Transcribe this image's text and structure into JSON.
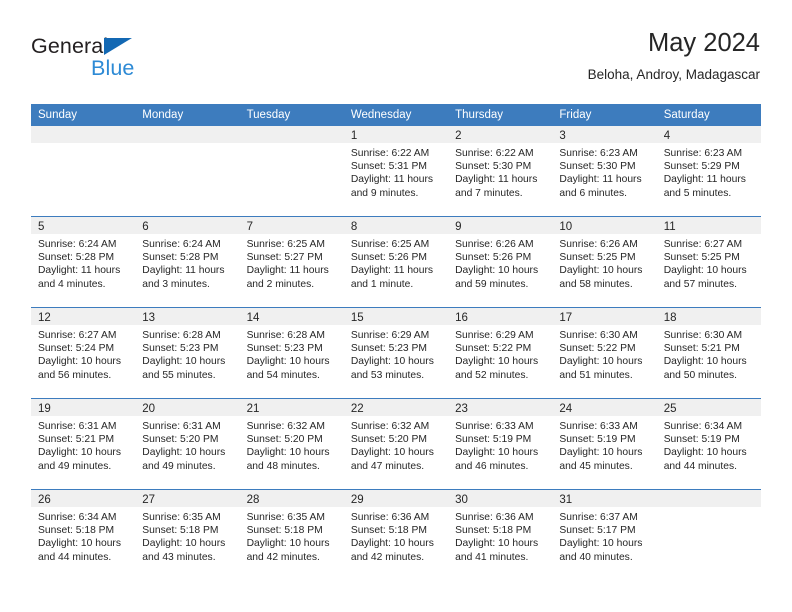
{
  "brand": {
    "name_top": "General",
    "name_bottom": "Blue",
    "triangle_color": "#1368b3",
    "blue_color": "#2d8ad5",
    "dark_color": "#231f20"
  },
  "header": {
    "title": "May 2024",
    "subtitle": "Beloha, Androy, Madagascar"
  },
  "theme": {
    "header_blue": "#3d7cbe",
    "daynum_band": "#f0f0f0",
    "text": "#262626"
  },
  "weekday_headers": [
    "Sunday",
    "Monday",
    "Tuesday",
    "Wednesday",
    "Thursday",
    "Friday",
    "Saturday"
  ],
  "weeks": [
    [
      {
        "day": "",
        "empty": true,
        "sunrise": "",
        "sunset": "",
        "daylight1": "",
        "daylight2": ""
      },
      {
        "day": "",
        "empty": true,
        "sunrise": "",
        "sunset": "",
        "daylight1": "",
        "daylight2": ""
      },
      {
        "day": "",
        "empty": true,
        "sunrise": "",
        "sunset": "",
        "daylight1": "",
        "daylight2": ""
      },
      {
        "day": "1",
        "empty": false,
        "sunrise": "Sunrise: 6:22 AM",
        "sunset": "Sunset: 5:31 PM",
        "daylight1": "Daylight: 11 hours",
        "daylight2": "and 9 minutes."
      },
      {
        "day": "2",
        "empty": false,
        "sunrise": "Sunrise: 6:22 AM",
        "sunset": "Sunset: 5:30 PM",
        "daylight1": "Daylight: 11 hours",
        "daylight2": "and 7 minutes."
      },
      {
        "day": "3",
        "empty": false,
        "sunrise": "Sunrise: 6:23 AM",
        "sunset": "Sunset: 5:30 PM",
        "daylight1": "Daylight: 11 hours",
        "daylight2": "and 6 minutes."
      },
      {
        "day": "4",
        "empty": false,
        "sunrise": "Sunrise: 6:23 AM",
        "sunset": "Sunset: 5:29 PM",
        "daylight1": "Daylight: 11 hours",
        "daylight2": "and 5 minutes."
      }
    ],
    [
      {
        "day": "5",
        "empty": false,
        "sunrise": "Sunrise: 6:24 AM",
        "sunset": "Sunset: 5:28 PM",
        "daylight1": "Daylight: 11 hours",
        "daylight2": "and 4 minutes."
      },
      {
        "day": "6",
        "empty": false,
        "sunrise": "Sunrise: 6:24 AM",
        "sunset": "Sunset: 5:28 PM",
        "daylight1": "Daylight: 11 hours",
        "daylight2": "and 3 minutes."
      },
      {
        "day": "7",
        "empty": false,
        "sunrise": "Sunrise: 6:25 AM",
        "sunset": "Sunset: 5:27 PM",
        "daylight1": "Daylight: 11 hours",
        "daylight2": "and 2 minutes."
      },
      {
        "day": "8",
        "empty": false,
        "sunrise": "Sunrise: 6:25 AM",
        "sunset": "Sunset: 5:26 PM",
        "daylight1": "Daylight: 11 hours",
        "daylight2": "and 1 minute."
      },
      {
        "day": "9",
        "empty": false,
        "sunrise": "Sunrise: 6:26 AM",
        "sunset": "Sunset: 5:26 PM",
        "daylight1": "Daylight: 10 hours",
        "daylight2": "and 59 minutes."
      },
      {
        "day": "10",
        "empty": false,
        "sunrise": "Sunrise: 6:26 AM",
        "sunset": "Sunset: 5:25 PM",
        "daylight1": "Daylight: 10 hours",
        "daylight2": "and 58 minutes."
      },
      {
        "day": "11",
        "empty": false,
        "sunrise": "Sunrise: 6:27 AM",
        "sunset": "Sunset: 5:25 PM",
        "daylight1": "Daylight: 10 hours",
        "daylight2": "and 57 minutes."
      }
    ],
    [
      {
        "day": "12",
        "empty": false,
        "sunrise": "Sunrise: 6:27 AM",
        "sunset": "Sunset: 5:24 PM",
        "daylight1": "Daylight: 10 hours",
        "daylight2": "and 56 minutes."
      },
      {
        "day": "13",
        "empty": false,
        "sunrise": "Sunrise: 6:28 AM",
        "sunset": "Sunset: 5:23 PM",
        "daylight1": "Daylight: 10 hours",
        "daylight2": "and 55 minutes."
      },
      {
        "day": "14",
        "empty": false,
        "sunrise": "Sunrise: 6:28 AM",
        "sunset": "Sunset: 5:23 PM",
        "daylight1": "Daylight: 10 hours",
        "daylight2": "and 54 minutes."
      },
      {
        "day": "15",
        "empty": false,
        "sunrise": "Sunrise: 6:29 AM",
        "sunset": "Sunset: 5:23 PM",
        "daylight1": "Daylight: 10 hours",
        "daylight2": "and 53 minutes."
      },
      {
        "day": "16",
        "empty": false,
        "sunrise": "Sunrise: 6:29 AM",
        "sunset": "Sunset: 5:22 PM",
        "daylight1": "Daylight: 10 hours",
        "daylight2": "and 52 minutes."
      },
      {
        "day": "17",
        "empty": false,
        "sunrise": "Sunrise: 6:30 AM",
        "sunset": "Sunset: 5:22 PM",
        "daylight1": "Daylight: 10 hours",
        "daylight2": "and 51 minutes."
      },
      {
        "day": "18",
        "empty": false,
        "sunrise": "Sunrise: 6:30 AM",
        "sunset": "Sunset: 5:21 PM",
        "daylight1": "Daylight: 10 hours",
        "daylight2": "and 50 minutes."
      }
    ],
    [
      {
        "day": "19",
        "empty": false,
        "sunrise": "Sunrise: 6:31 AM",
        "sunset": "Sunset: 5:21 PM",
        "daylight1": "Daylight: 10 hours",
        "daylight2": "and 49 minutes."
      },
      {
        "day": "20",
        "empty": false,
        "sunrise": "Sunrise: 6:31 AM",
        "sunset": "Sunset: 5:20 PM",
        "daylight1": "Daylight: 10 hours",
        "daylight2": "and 49 minutes."
      },
      {
        "day": "21",
        "empty": false,
        "sunrise": "Sunrise: 6:32 AM",
        "sunset": "Sunset: 5:20 PM",
        "daylight1": "Daylight: 10 hours",
        "daylight2": "and 48 minutes."
      },
      {
        "day": "22",
        "empty": false,
        "sunrise": "Sunrise: 6:32 AM",
        "sunset": "Sunset: 5:20 PM",
        "daylight1": "Daylight: 10 hours",
        "daylight2": "and 47 minutes."
      },
      {
        "day": "23",
        "empty": false,
        "sunrise": "Sunrise: 6:33 AM",
        "sunset": "Sunset: 5:19 PM",
        "daylight1": "Daylight: 10 hours",
        "daylight2": "and 46 minutes."
      },
      {
        "day": "24",
        "empty": false,
        "sunrise": "Sunrise: 6:33 AM",
        "sunset": "Sunset: 5:19 PM",
        "daylight1": "Daylight: 10 hours",
        "daylight2": "and 45 minutes."
      },
      {
        "day": "25",
        "empty": false,
        "sunrise": "Sunrise: 6:34 AM",
        "sunset": "Sunset: 5:19 PM",
        "daylight1": "Daylight: 10 hours",
        "daylight2": "and 44 minutes."
      }
    ],
    [
      {
        "day": "26",
        "empty": false,
        "sunrise": "Sunrise: 6:34 AM",
        "sunset": "Sunset: 5:18 PM",
        "daylight1": "Daylight: 10 hours",
        "daylight2": "and 44 minutes."
      },
      {
        "day": "27",
        "empty": false,
        "sunrise": "Sunrise: 6:35 AM",
        "sunset": "Sunset: 5:18 PM",
        "daylight1": "Daylight: 10 hours",
        "daylight2": "and 43 minutes."
      },
      {
        "day": "28",
        "empty": false,
        "sunrise": "Sunrise: 6:35 AM",
        "sunset": "Sunset: 5:18 PM",
        "daylight1": "Daylight: 10 hours",
        "daylight2": "and 42 minutes."
      },
      {
        "day": "29",
        "empty": false,
        "sunrise": "Sunrise: 6:36 AM",
        "sunset": "Sunset: 5:18 PM",
        "daylight1": "Daylight: 10 hours",
        "daylight2": "and 42 minutes."
      },
      {
        "day": "30",
        "empty": false,
        "sunrise": "Sunrise: 6:36 AM",
        "sunset": "Sunset: 5:18 PM",
        "daylight1": "Daylight: 10 hours",
        "daylight2": "and 41 minutes."
      },
      {
        "day": "31",
        "empty": false,
        "sunrise": "Sunrise: 6:37 AM",
        "sunset": "Sunset: 5:17 PM",
        "daylight1": "Daylight: 10 hours",
        "daylight2": "and 40 minutes."
      },
      {
        "day": "",
        "empty": true,
        "sunrise": "",
        "sunset": "",
        "daylight1": "",
        "daylight2": ""
      }
    ]
  ]
}
